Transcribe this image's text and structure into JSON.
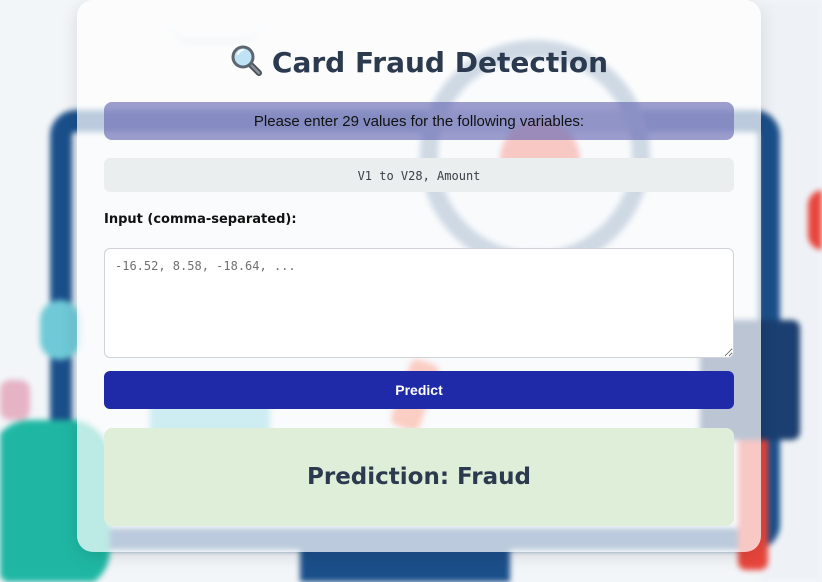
{
  "page": {
    "title": "Card Fraud Detection",
    "title_icon": "magnifying-glass-icon"
  },
  "form": {
    "instructions": "Please enter 29 values for the following variables:",
    "variables": "V1 to V28, Amount",
    "input_label": "Input (comma-separated):",
    "input_placeholder": "-16.52, 8.58, -18.64, ...",
    "input_value": "",
    "predict_label": "Predict"
  },
  "result": {
    "prediction_text": "Prediction: Fraud"
  },
  "colors": {
    "button": "#1f2aa8",
    "instructions_bg": "#696ab4",
    "result_bg": "#dfeed8",
    "title_text": "#2b3a4e"
  }
}
